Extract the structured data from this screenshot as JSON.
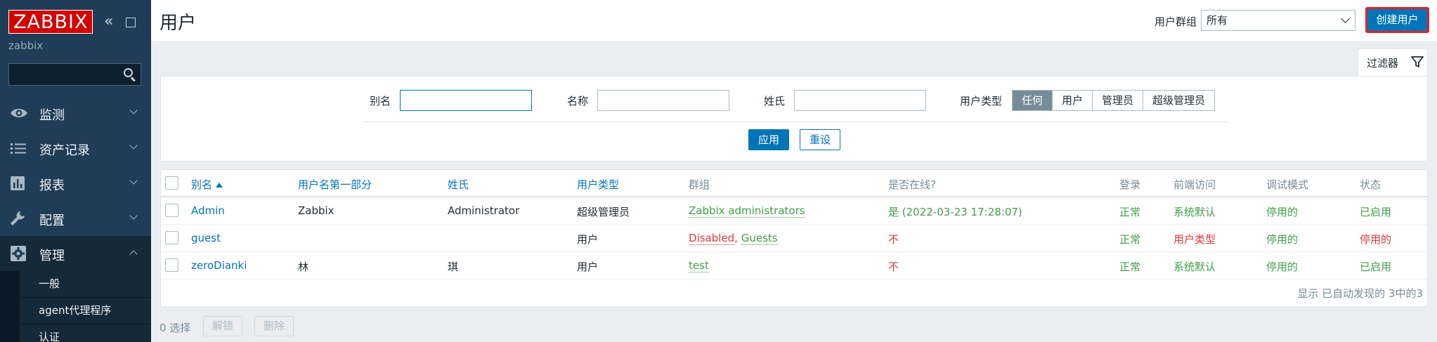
{
  "sidebar": {
    "logo": "ZABBIX",
    "server_name": "zabbix",
    "search_value": "",
    "items": [
      {
        "label": "监测",
        "icon": "eye-icon"
      },
      {
        "label": "资产记录",
        "icon": "list-icon"
      },
      {
        "label": "报表",
        "icon": "bar-chart-icon"
      },
      {
        "label": "配置",
        "icon": "wrench-icon"
      },
      {
        "label": "管理",
        "icon": "gear-icon",
        "expanded": true
      }
    ],
    "submenu": [
      {
        "label": "一般"
      },
      {
        "label": "agent代理程序"
      },
      {
        "label": "认证"
      }
    ]
  },
  "header": {
    "title": "用户",
    "user_group_label": "用户群组",
    "user_group_value": "所有",
    "create_button": "创建用户"
  },
  "filter": {
    "tab_label": "过滤器",
    "alias_label": "别名",
    "alias_value": "",
    "name_label": "名称",
    "name_value": "",
    "surname_label": "姓氏",
    "surname_value": "",
    "user_type_label": "用户类型",
    "user_type_options": [
      "任何",
      "用户",
      "管理员",
      "超级管理员"
    ],
    "user_type_selected": "任何",
    "apply_button": "应用",
    "reset_button": "重设"
  },
  "table": {
    "columns": [
      "别名",
      "用户名第一部分",
      "姓氏",
      "用户类型",
      "群组",
      "是否在线?",
      "登录",
      "前端访问",
      "调试模式",
      "状态"
    ],
    "rows": [
      {
        "alias": "Admin",
        "name": "Zabbix",
        "surname": "Administrator",
        "user_type": "超级管理员",
        "groups": [
          {
            "text": "Zabbix administrators",
            "color": "green"
          }
        ],
        "online": "是 (2022-03-23 17:28:07)",
        "online_color": "green",
        "login": "正常",
        "frontend_access": "系统默认",
        "frontend_color": "green",
        "debug_mode": "停用的",
        "status": "已启用",
        "status_color": "green"
      },
      {
        "alias": "guest",
        "name": "",
        "surname": "",
        "user_type": "用户",
        "groups": [
          {
            "text": "Disabled",
            "color": "red"
          },
          {
            "text": "Guests",
            "color": "green"
          }
        ],
        "online": "不",
        "online_color": "red",
        "login": "正常",
        "frontend_access": "用户类型",
        "frontend_color": "red",
        "debug_mode": "停用的",
        "status": "停用的",
        "status_color": "red"
      },
      {
        "alias": "zeroDianki",
        "name": "林",
        "surname": "琪",
        "user_type": "用户",
        "groups": [
          {
            "text": "test",
            "color": "green"
          }
        ],
        "online": "不",
        "online_color": "red",
        "login": "正常",
        "frontend_access": "系统默认",
        "frontend_color": "green",
        "debug_mode": "停用的",
        "status": "已启用",
        "status_color": "green"
      }
    ],
    "footer": "显示 已自动发现的 3中的3"
  },
  "bulk_actions": {
    "selected_count": "0 选择",
    "unblock_button": "解锁",
    "delete_button": "删除"
  },
  "colors": {
    "sidebar_bg": "#1f3d57",
    "accent": "#0275b8",
    "ok_green": "#429e47",
    "bad_red": "#e33734",
    "logo_red": "#d40000"
  }
}
